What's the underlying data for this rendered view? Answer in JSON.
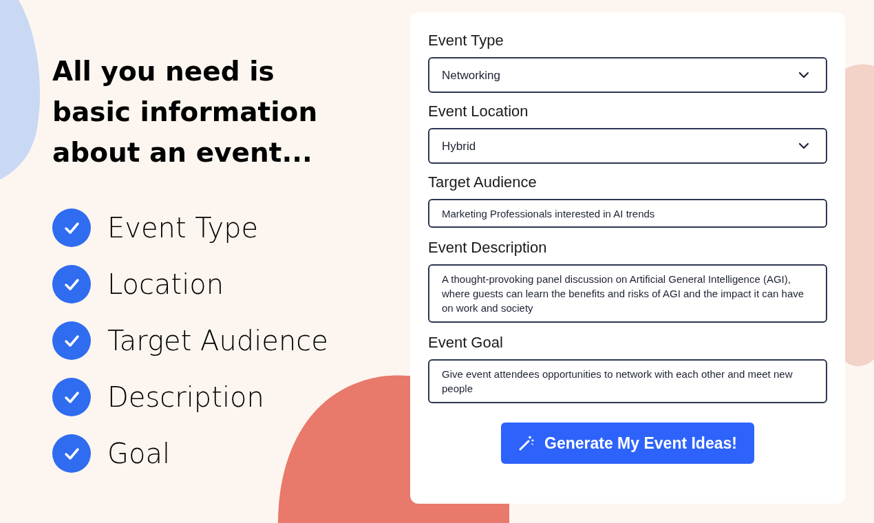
{
  "heading": "All you need is basic information about an event...",
  "checklist": [
    {
      "label": "Event Type",
      "checked": true
    },
    {
      "label": "Location",
      "checked": true
    },
    {
      "label": "Target Audience",
      "checked": true
    },
    {
      "label": "Description",
      "checked": true
    },
    {
      "label": "Goal",
      "checked": true
    }
  ],
  "form": {
    "fields": [
      {
        "label": "Event Type",
        "kind": "select",
        "value": "Networking"
      },
      {
        "label": "Event Location",
        "kind": "select",
        "value": "Hybrid"
      },
      {
        "label": "Target Audience",
        "kind": "text",
        "value": "Marketing Professionals interested in AI trends"
      },
      {
        "label": "Event Description",
        "kind": "textarea",
        "value": "A thought-provoking panel discussion on Artificial General Intelligence (AGI), where guests can learn the benefits and risks of AGI and the impact it can have on work and society"
      },
      {
        "label": "Event Goal",
        "kind": "textarea",
        "value": "Give event attendees opportunities to network with each other and meet new people"
      }
    ],
    "submit": "Generate My Event Ideas!"
  }
}
